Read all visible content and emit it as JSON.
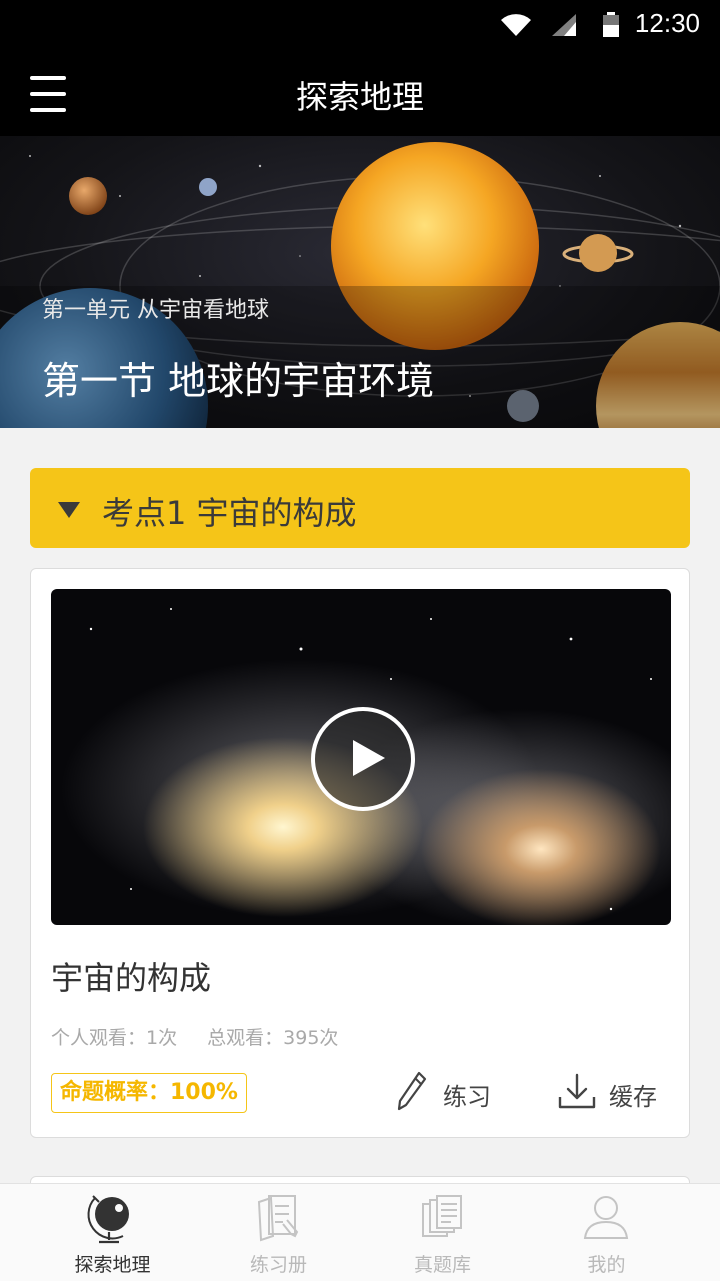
{
  "status_bar": {
    "time": "12:30",
    "icons": [
      "wifi-icon",
      "signal-icon",
      "battery-icon"
    ]
  },
  "app_bar": {
    "title": "探索地理",
    "menu_icon": "hamburger-menu-icon"
  },
  "hero": {
    "unit": "第一单元 从宇宙看地球",
    "section": "第一节 地球的宇宙环境"
  },
  "topic": {
    "label": "考点1 宇宙的构成",
    "expanded": true,
    "color": "#f5c518"
  },
  "video_card": {
    "title": "宇宙的构成",
    "personal_views": "个人观看：1次",
    "total_views": "总观看：395次",
    "probability": "命题概率：100%",
    "practice_label": "练习",
    "cache_label": "缓存"
  },
  "tabs": [
    {
      "label": "探索地理",
      "icon": "globe-icon",
      "active": true
    },
    {
      "label": "练习册",
      "icon": "notebook-icon",
      "active": false
    },
    {
      "label": "真题库",
      "icon": "document-stack-icon",
      "active": false
    },
    {
      "label": "我的",
      "icon": "user-icon",
      "active": false
    }
  ],
  "colors": {
    "accent": "#f5c518",
    "bar": "#000000",
    "page_bg": "#f2f2f2"
  }
}
